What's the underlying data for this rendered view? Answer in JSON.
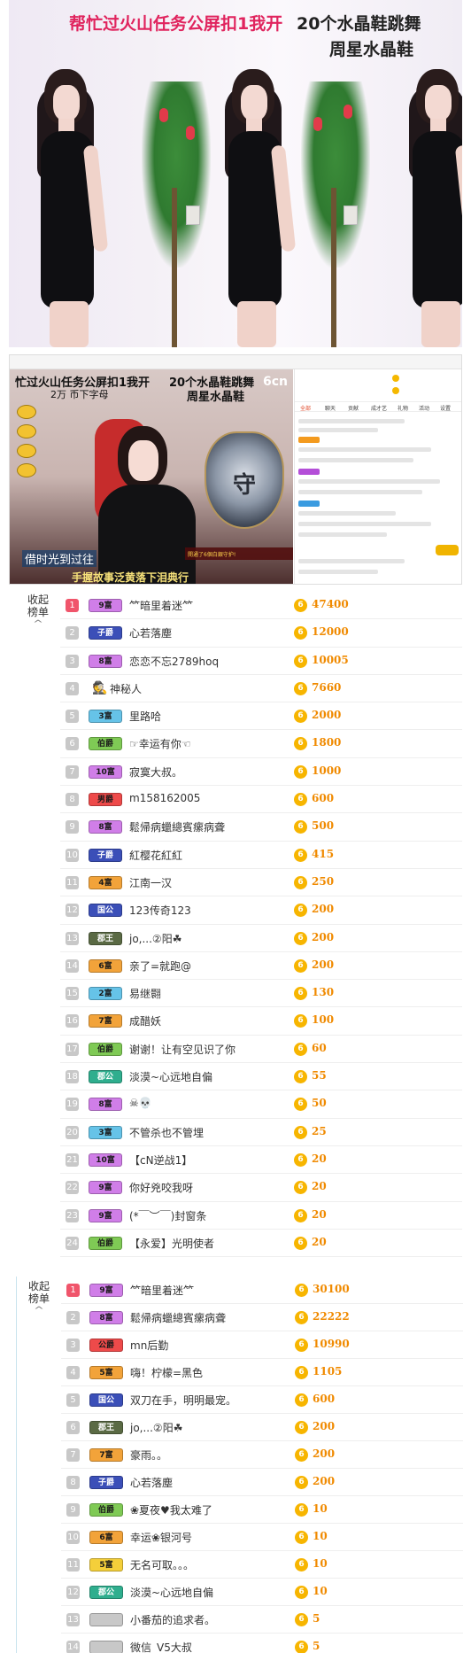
{
  "banner": {
    "title_left": "帮忙过火山任务公屏扣1我开",
    "title_right_1": "20个水晶鞋跳舞",
    "title_right_2": "周星水晶鞋"
  },
  "stream": {
    "title_left_1": "忙过火山任务公屏扣1我开",
    "title_left_2": "2万 币下字母",
    "title_right_1": "20个水晶鞋跳舞",
    "title_right_2": "周星水晶鞋",
    "badge": "6cn",
    "subtitle_1": "借时光到过往",
    "subtitle_2": "手握故事泛黄落下泪典行",
    "crest_letter": "守",
    "gift_banner": "開通了6個白銀守护!",
    "chat_tabs": [
      "全部",
      "聊天",
      "贡献",
      "成才艺",
      "礼物",
      "活动",
      "设置"
    ]
  },
  "board1": {
    "collapse_label_1": "收起",
    "collapse_label_2": "榜单",
    "rows": [
      {
        "rank": "1",
        "badge": "9富",
        "badge_style": "b-purple",
        "name": "⺮暗里着迷⺮",
        "amount": "47400"
      },
      {
        "rank": "2",
        "badge": "子爵",
        "badge_style": "b-navy",
        "name": "心若落塵",
        "amount": "12000"
      },
      {
        "rank": "3",
        "badge": "8富",
        "badge_style": "b-purple",
        "name": "恋恋不忘2789hoq",
        "amount": "10005"
      },
      {
        "rank": "4",
        "badge": "",
        "badge_style": "anon",
        "name": "神秘人",
        "amount": "7660"
      },
      {
        "rank": "5",
        "badge": "3富",
        "badge_style": "b-blue",
        "name": "里路哈",
        "amount": "2000"
      },
      {
        "rank": "6",
        "badge": "伯爵",
        "badge_style": "b-green",
        "name": "☞幸运有你☜",
        "amount": "1800"
      },
      {
        "rank": "7",
        "badge": "10富",
        "badge_style": "b-purple",
        "name": "寂寞大叔。",
        "amount": "1000"
      },
      {
        "rank": "8",
        "badge": "男爵",
        "badge_style": "b-red",
        "name": "m158162005",
        "amount": "600"
      },
      {
        "rank": "9",
        "badge": "8富",
        "badge_style": "b-purple",
        "name": "鬆帰病蠟總賓瘰病聋",
        "amount": "500"
      },
      {
        "rank": "10",
        "badge": "子爵",
        "badge_style": "b-navy",
        "name": "紅樱花紅紅",
        "amount": "415"
      },
      {
        "rank": "11",
        "badge": "4富",
        "badge_style": "b-orange",
        "name": "江南一汉",
        "amount": "250"
      },
      {
        "rank": "12",
        "badge": "国公",
        "badge_style": "b-navy",
        "name": "123传奇123",
        "amount": "200"
      },
      {
        "rank": "13",
        "badge": "郡王",
        "badge_style": "b-dark",
        "name": "jo,...②阳☘",
        "amount": "200"
      },
      {
        "rank": "14",
        "badge": "6富",
        "badge_style": "b-orange",
        "name": "亲了=就跑@",
        "amount": "200"
      },
      {
        "rank": "15",
        "badge": "2富",
        "badge_style": "b-blue",
        "name": "易继翾",
        "amount": "130"
      },
      {
        "rank": "16",
        "badge": "7富",
        "badge_style": "b-orange",
        "name": "成醋妖",
        "amount": "100"
      },
      {
        "rank": "17",
        "badge": "伯爵",
        "badge_style": "b-green",
        "name": "谢谢！让有空见识了你",
        "amount": "60"
      },
      {
        "rank": "18",
        "badge": "郡公",
        "badge_style": "b-teal",
        "name": "淡漠~心远地自偏",
        "amount": "55"
      },
      {
        "rank": "19",
        "badge": "8富",
        "badge_style": "b-purple",
        "name": "☠💀",
        "amount": "50"
      },
      {
        "rank": "20",
        "badge": "3富",
        "badge_style": "b-blue",
        "name": "不管杀也不管埋",
        "amount": "25"
      },
      {
        "rank": "21",
        "badge": "10富",
        "badge_style": "b-purple",
        "name": "【cN逆战1】",
        "amount": "20"
      },
      {
        "rank": "22",
        "badge": "9富",
        "badge_style": "b-purple",
        "name": "你好兇咬我呀",
        "amount": "20"
      },
      {
        "rank": "23",
        "badge": "9富",
        "badge_style": "b-purple",
        "name": "(*￣︶￣)封窗条",
        "amount": "20"
      },
      {
        "rank": "24",
        "badge": "伯爵",
        "badge_style": "b-green",
        "name": "【永爱】光明使者",
        "amount": "20"
      }
    ]
  },
  "board2": {
    "collapse_label_1": "收起",
    "collapse_label_2": "榜单",
    "rows": [
      {
        "rank": "1",
        "badge": "9富",
        "badge_style": "b-purple",
        "name": "⺮暗里着迷⺮",
        "amount": "30100"
      },
      {
        "rank": "2",
        "badge": "8富",
        "badge_style": "b-purple",
        "name": "鬆帰病蠟總賓瘰病聋",
        "amount": "22222"
      },
      {
        "rank": "3",
        "badge": "公爵",
        "badge_style": "b-red",
        "name": "mn后勤",
        "amount": "10990"
      },
      {
        "rank": "4",
        "badge": "5富",
        "badge_style": "b-orange",
        "name": "嗨！柠檬=黑色",
        "amount": "1105"
      },
      {
        "rank": "5",
        "badge": "国公",
        "badge_style": "b-navy",
        "name": "双刀在手，明明最宠。",
        "amount": "600"
      },
      {
        "rank": "6",
        "badge": "郡王",
        "badge_style": "b-dark",
        "name": "jo,...②阳☘",
        "amount": "200"
      },
      {
        "rank": "7",
        "badge": "7富",
        "badge_style": "b-orange",
        "name": "豪雨。。",
        "amount": "200"
      },
      {
        "rank": "8",
        "badge": "子爵",
        "badge_style": "b-navy",
        "name": "心若落塵",
        "amount": "200"
      },
      {
        "rank": "9",
        "badge": "伯爵",
        "badge_style": "b-green",
        "name": "❀夏夜♥我太难了",
        "amount": "10"
      },
      {
        "rank": "10",
        "badge": "6富",
        "badge_style": "b-orange",
        "name": "幸运❀银河号",
        "amount": "10"
      },
      {
        "rank": "11",
        "badge": "5富",
        "badge_style": "b-yellow",
        "name": "无名可取。。。",
        "amount": "10"
      },
      {
        "rank": "12",
        "badge": "郡公",
        "badge_style": "b-teal",
        "name": "淡漠~心远地自偏",
        "amount": "10"
      },
      {
        "rank": "13",
        "badge": "",
        "badge_style": "b-gray",
        "name": "小番茄的追求者。",
        "amount": "5"
      },
      {
        "rank": "14",
        "badge": "",
        "badge_style": "b-gray",
        "name": "微信_V5大叔",
        "amount": "5"
      }
    ]
  },
  "coin_symbol": "6",
  "colors": {
    "rank_top": "#f0556b",
    "rank_other": "#c8c8c8",
    "coin": "#f7b500",
    "amount": "#f08a00"
  }
}
